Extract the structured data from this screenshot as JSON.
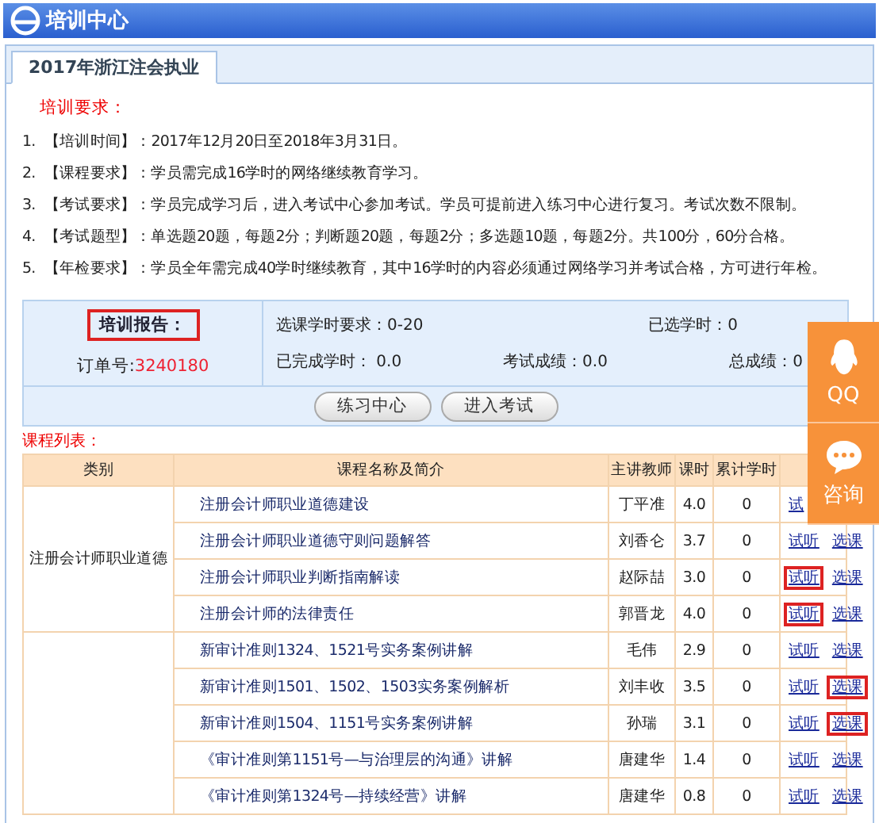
{
  "header": {
    "title": "培训中心"
  },
  "tabs": [
    {
      "label": "2017年浙江注会执业",
      "selected": true
    }
  ],
  "requirements": {
    "heading": "培训要求：",
    "items": [
      {
        "number": "1.",
        "text": "【培训时间】：2017年12月20日至2018年3月31日。"
      },
      {
        "number": "2.",
        "text": "【课程要求】：学员需完成16学时的网络继续教育学习。"
      },
      {
        "number": "3.",
        "text": "【考试要求】：学员完成学习后，进入考试中心参加考试。学员可提前进入练习中心进行复习。考试次数不限制。"
      },
      {
        "number": "4.",
        "text": "【考试题型】：单选题20题，每题2分；判断题20题，每题2分；多选题10题，每题2分。共100分，60分合格。"
      },
      {
        "number": "5.",
        "text": "【年检要求】：学员全年需完成40学时继续教育，其中16学时的内容必须通过网络学习并考试合格，方可进行年检。"
      }
    ]
  },
  "report": {
    "title": "培训报告：",
    "title_highlighted": true,
    "order_label": "订单号:",
    "order_number": "3240180",
    "stats": [
      {
        "text": "选课学时要求：0-20"
      },
      {
        "text": "已选学时：0"
      },
      {
        "text": "已完成学时： 0.0"
      },
      {
        "text": "考试成绩：0.0"
      },
      {
        "text": "总成绩：0"
      }
    ],
    "buttons": [
      "练习中心",
      "进入考试"
    ]
  },
  "course_list": {
    "heading": "课程列表：",
    "columns": [
      "类别",
      "课程名称及简介",
      "主讲教师",
      "课时",
      "累计学时"
    ],
    "groups": [
      {
        "category": "注册会计师职业道德",
        "courses": [
          {
            "name": "注册会计师职业道德建设",
            "teacher": "丁平准",
            "hours": "4.0",
            "accumulated": "0",
            "listen": "试",
            "listen_highlighted": false
          },
          {
            "name": "注册会计师职业道德守则问题解答",
            "teacher": "刘香仑",
            "hours": "3.7",
            "accumulated": "0",
            "listen": "试听",
            "listen_highlighted": false,
            "select": "选课",
            "select_highlighted": false
          },
          {
            "name": "注册会计师职业判断指南解读",
            "teacher": "赵际喆",
            "hours": "3.0",
            "accumulated": "0",
            "listen": "试听",
            "listen_highlighted": true,
            "select": "选课",
            "select_highlighted": false
          },
          {
            "name": "注册会计师的法律责任",
            "teacher": "郭晋龙",
            "hours": "4.0",
            "accumulated": "0",
            "listen": "试听",
            "listen_highlighted": true,
            "select": "选课",
            "select_highlighted": false
          }
        ]
      },
      {
        "courses": [
          {
            "name": "新审计准则1324、1521号实务案例讲解",
            "teacher": "毛伟",
            "hours": "2.9",
            "accumulated": "0",
            "listen": "试听",
            "listen_highlighted": false,
            "select": "选课",
            "select_highlighted": false
          },
          {
            "name": "新审计准则1501、1502、1503实务案例解析",
            "teacher": "刘丰收",
            "hours": "3.5",
            "accumulated": "0",
            "listen": "试听",
            "listen_highlighted": false,
            "select": "选课",
            "select_highlighted": true
          },
          {
            "name": "新审计准则1504、1151号实务案例讲解",
            "teacher": "孙瑞",
            "hours": "3.1",
            "accumulated": "0",
            "listen": "试听",
            "listen_highlighted": false,
            "select": "选课",
            "select_highlighted": true
          },
          {
            "name": "《审计准则第1151号—与治理层的沟通》讲解",
            "teacher": "唐建华",
            "hours": "1.4",
            "accumulated": "0",
            "listen": "试听",
            "listen_highlighted": false,
            "select": "选课",
            "select_highlighted": false
          },
          {
            "name": "《审计准则第1324号—持续经营》讲解",
            "teacher": "唐建华",
            "hours": "0.8",
            "accumulated": "0",
            "listen": "试听",
            "listen_highlighted": false,
            "select": "选课",
            "select_highlighted": false
          }
        ]
      }
    ]
  },
  "float_panel": [
    {
      "kind": "qq",
      "label": "QQ"
    },
    {
      "kind": "chat",
      "label": "咨询"
    }
  ]
}
